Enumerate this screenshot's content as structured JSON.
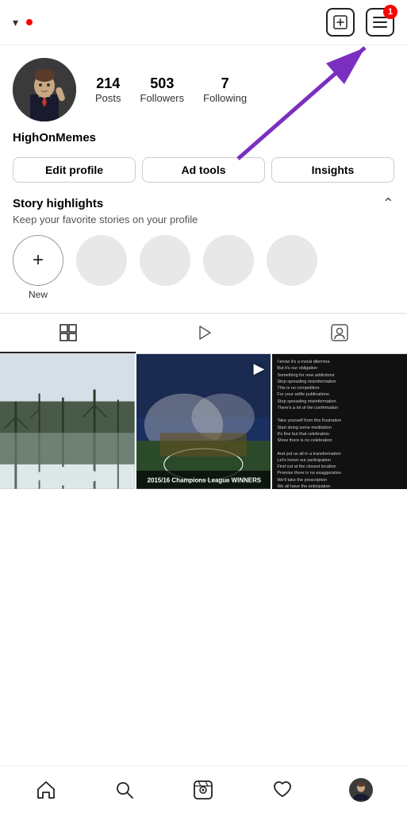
{
  "header": {
    "username": "HighOnMemes",
    "chevron": "▾",
    "add_icon": "+",
    "menu_icon": "≡",
    "notification_count": "1"
  },
  "profile": {
    "name": "HighOnMemes",
    "stats": {
      "posts": {
        "count": "214",
        "label": "Posts"
      },
      "followers": {
        "count": "503",
        "label": "Followers"
      },
      "following": {
        "count": "7",
        "label": "Following"
      }
    }
  },
  "buttons": {
    "edit_profile": "Edit profile",
    "ad_tools": "Ad tools",
    "insights": "Insights"
  },
  "story_highlights": {
    "title": "Story highlights",
    "subtitle": "Keep your favorite stories on your profile",
    "new_label": "New",
    "chevron_up": "^"
  },
  "tabs": {
    "grid": "⊞",
    "reels": "▷",
    "tagged": "👤"
  },
  "posts": [
    {
      "type": "snow",
      "alt": "Snow scene"
    },
    {
      "type": "soccer",
      "alt": "Soccer championship",
      "banner": "2015/16 Champions League WINNERS",
      "has_play": true
    },
    {
      "type": "text",
      "alt": "Text post"
    }
  ],
  "soccer_banner": "2015/16 Champions League WINNERS",
  "bottom_nav": {
    "home": "Home",
    "search": "Search",
    "reels": "Reels",
    "likes": "Likes",
    "profile": "Profile"
  }
}
